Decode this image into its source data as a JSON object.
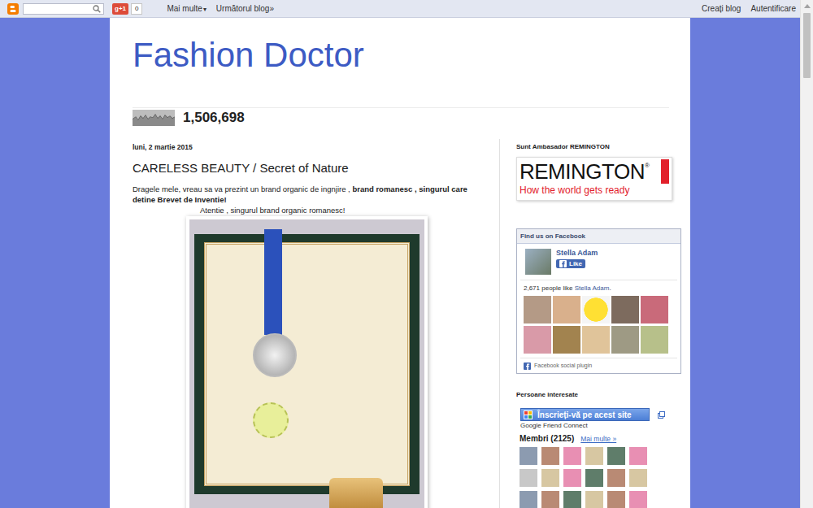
{
  "navbar": {
    "gplus": "g+1",
    "gplus_count": "0",
    "more": "Mai multe",
    "more_caret": "▾",
    "next_blog": "Următorul blog»",
    "create_blog": "Creați blog",
    "sign_in": "Autentificare"
  },
  "blog": {
    "title": "Fashion Doctor",
    "pageviews": "1,506,698"
  },
  "post": {
    "date": "luni, 2 martie 2015",
    "title": "CARELESS BEAUTY / Secret of Nature",
    "intro": [
      {
        "text": "Dragele mele, vreau sa va prezint un brand organic  de ingnjire , ",
        "bold": false
      },
      {
        "text": "brand romanesc , singurul care detine Brevet de Inventie!",
        "bold": true
      }
    ],
    "note": "Atentie , singurul brand organic romanesc!"
  },
  "sidebar": {
    "ambassador": {
      "title": "Sunt Ambasador REMINGTON",
      "logo": "REMINGTON",
      "logo_mark": "®",
      "tagline": "How the world gets ready"
    },
    "facebook": {
      "header": "Find us on Facebook",
      "page": "Stella Adam",
      "like": "Like",
      "count_text": "2,671 people like ",
      "count_link": "Stella Adam",
      "count_end": ".",
      "footer": "Facebook social plugin"
    },
    "followers": {
      "title": "Persoane interesate",
      "join": "Înscrieți-vă pe acest site",
      "provider": "Google Friend Connect",
      "members": "Membri (2125)",
      "more": "Mai multe »"
    }
  }
}
